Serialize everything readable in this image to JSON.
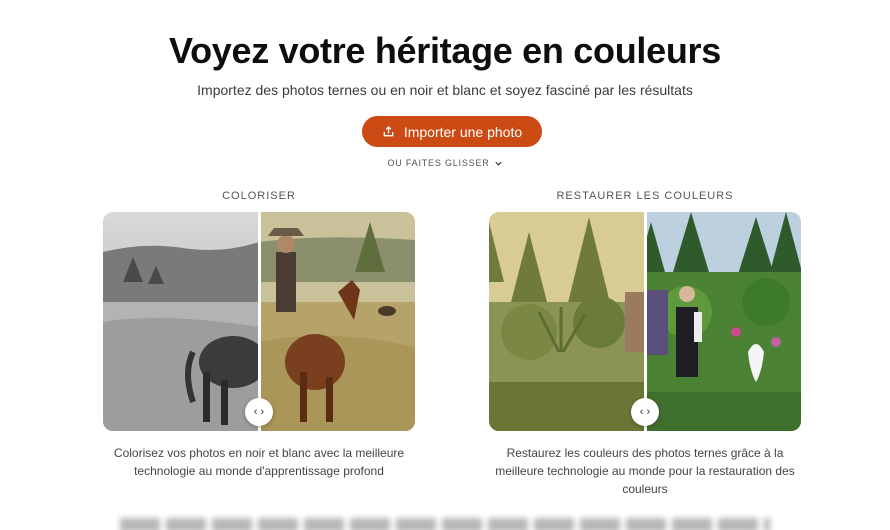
{
  "hero": {
    "title": "Voyez votre héritage en couleurs",
    "subtitle": "Importez des photos ternes ou en noir et blanc et soyez fasciné par les résultats",
    "upload_label": "Importer une photo",
    "drag_label": "OU FAITES GLISSER"
  },
  "features": [
    {
      "label": "COLORISER",
      "caption_line1": "Colorisez vos photos en noir et blanc avec la meilleure",
      "caption_line2": "technologie au monde d'apprentissage profond"
    },
    {
      "label": "RESTAURER LES COULEURS",
      "caption_line1": "Restaurez les couleurs des photos ternes grâce à la",
      "caption_line2": "meilleure technologie au monde pour la restauration des",
      "caption_line3": "couleurs"
    }
  ],
  "slider_handle": "‹ ›",
  "colors": {
    "accent": "#cc4a14",
    "text": "#1b1b1b"
  },
  "icons": {
    "upload": "upload-icon",
    "chevron": "chevron-down-icon",
    "slider": "slider-handle-icon"
  }
}
